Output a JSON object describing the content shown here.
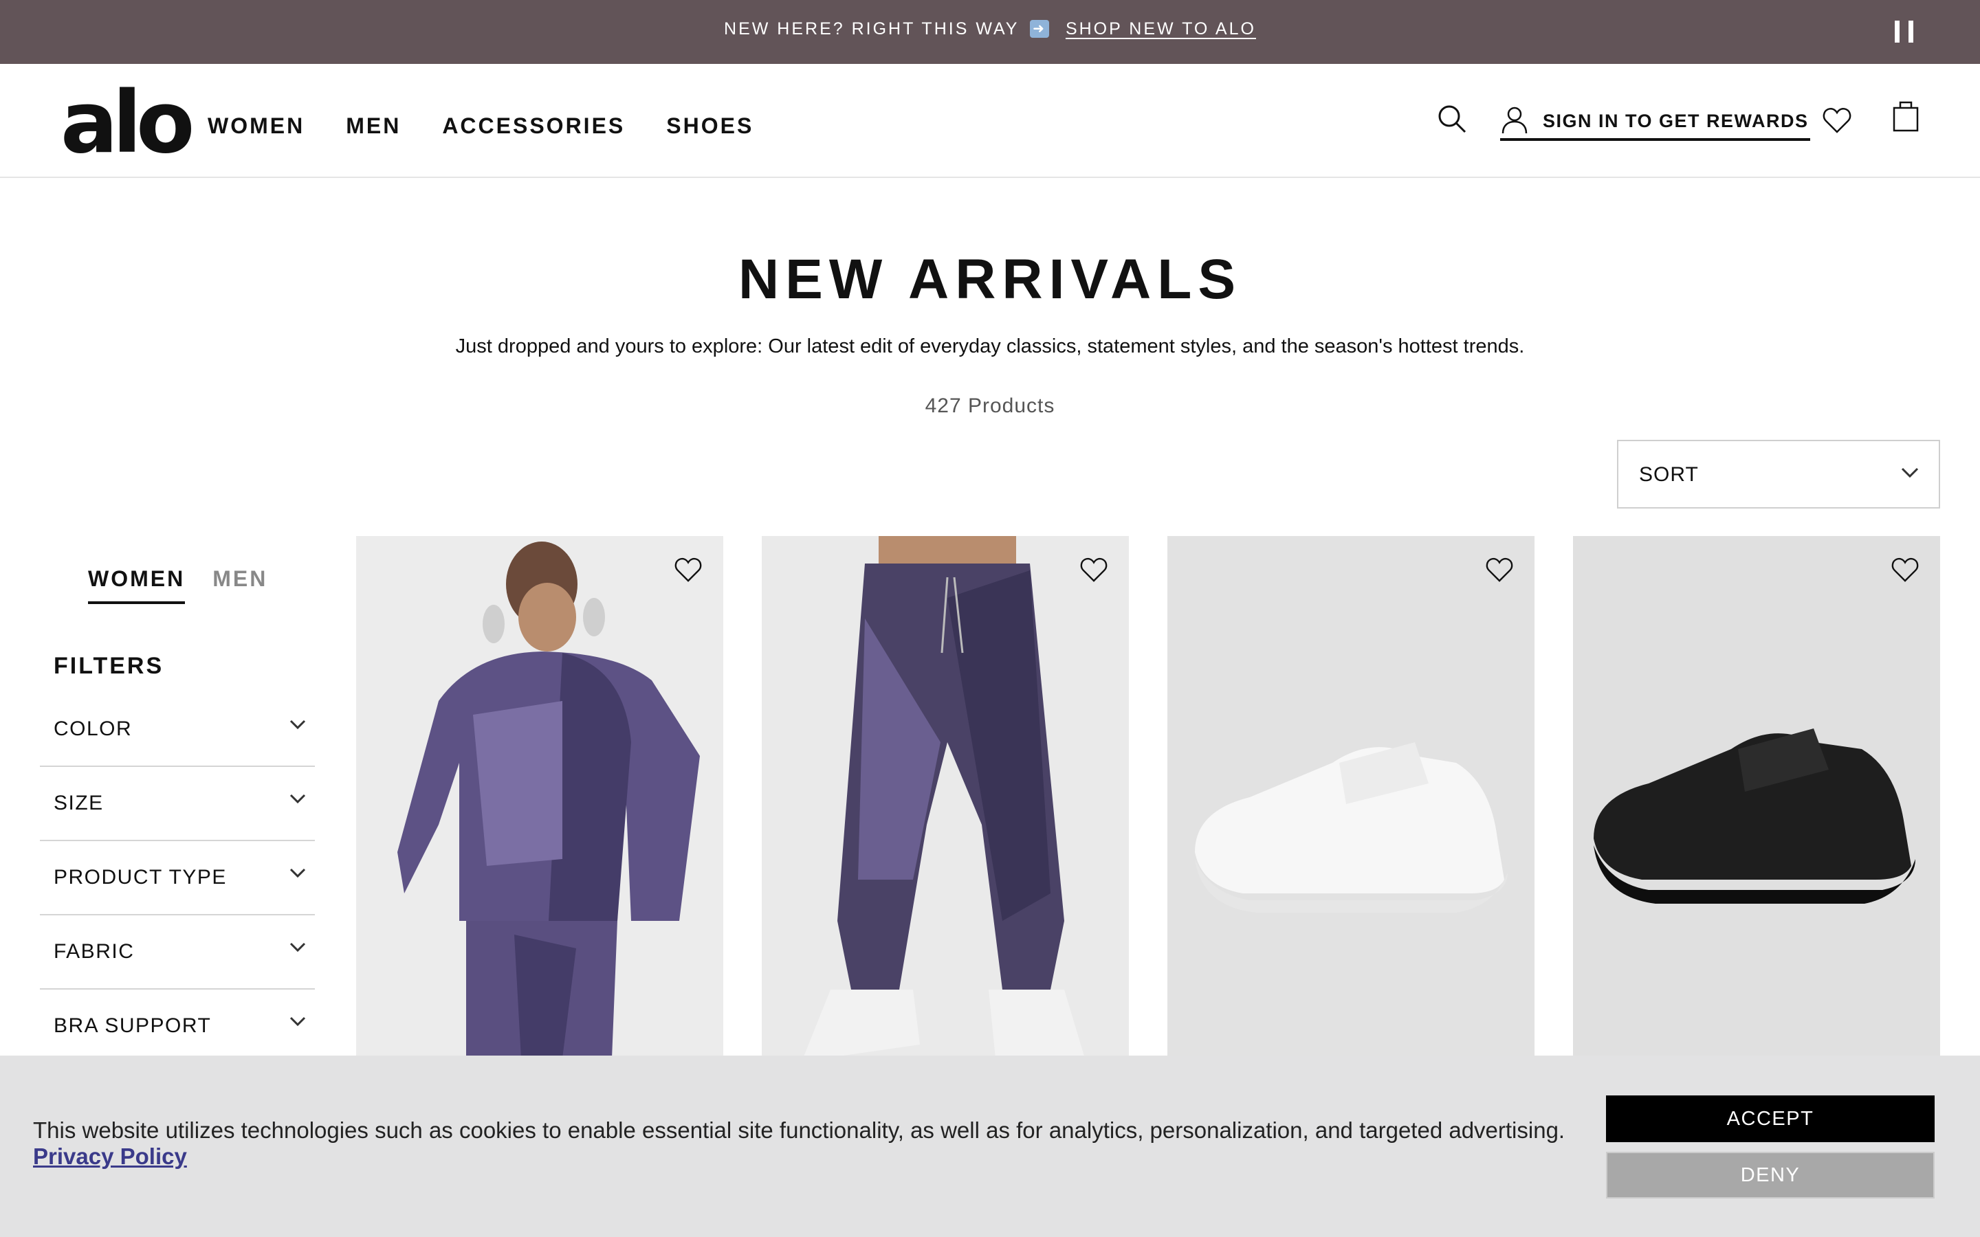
{
  "promo": {
    "text": "NEW HERE? RIGHT THIS WAY",
    "arrow_icon": "right-arrow-emoji",
    "link": "SHOP NEW TO ALO",
    "pause_icon": "pause-icon"
  },
  "header": {
    "logo": "alo",
    "nav": [
      "WOMEN",
      "MEN",
      "ACCESSORIES",
      "SHOES"
    ],
    "account_label": "SIGN IN TO GET REWARDS"
  },
  "page": {
    "title": "NEW ARRIVALS",
    "subtitle": "Just dropped and yours to explore: Our latest edit of everyday classics, statement styles, and the season's hottest trends.",
    "count": "427 Products",
    "sort_label": "SORT"
  },
  "sidebar": {
    "tabs": [
      "WOMEN",
      "MEN"
    ],
    "active_tab": "WOMEN",
    "filters_label": "FILTERS",
    "filters": [
      "COLOR",
      "SIZE",
      "PRODUCT TYPE",
      "FABRIC",
      "BRA SUPPORT"
    ]
  },
  "products": [
    {
      "image": "purple-hoodie-model",
      "bg": "#ececec"
    },
    {
      "image": "purple-sweatpants-model",
      "bg": "#eaeaea"
    },
    {
      "image": "white-sneaker",
      "bg": "#e2e2e2"
    },
    {
      "image": "black-sneaker",
      "bg": "#e0e0e0"
    }
  ],
  "cookie": {
    "text": "This website utilizes technologies such as cookies to enable essential site functionality, as well as for analytics, personalization, and targeted advertising.",
    "privacy_link": "Privacy Policy",
    "accept": "ACCEPT",
    "deny": "DENY"
  },
  "colors": {
    "promo_bg": "#625458",
    "cookie_bg": "#e2e2e3",
    "accept_bg": "#000000",
    "deny_bg": "#a8a8a8",
    "privacy_link": "#3a3a8a"
  }
}
